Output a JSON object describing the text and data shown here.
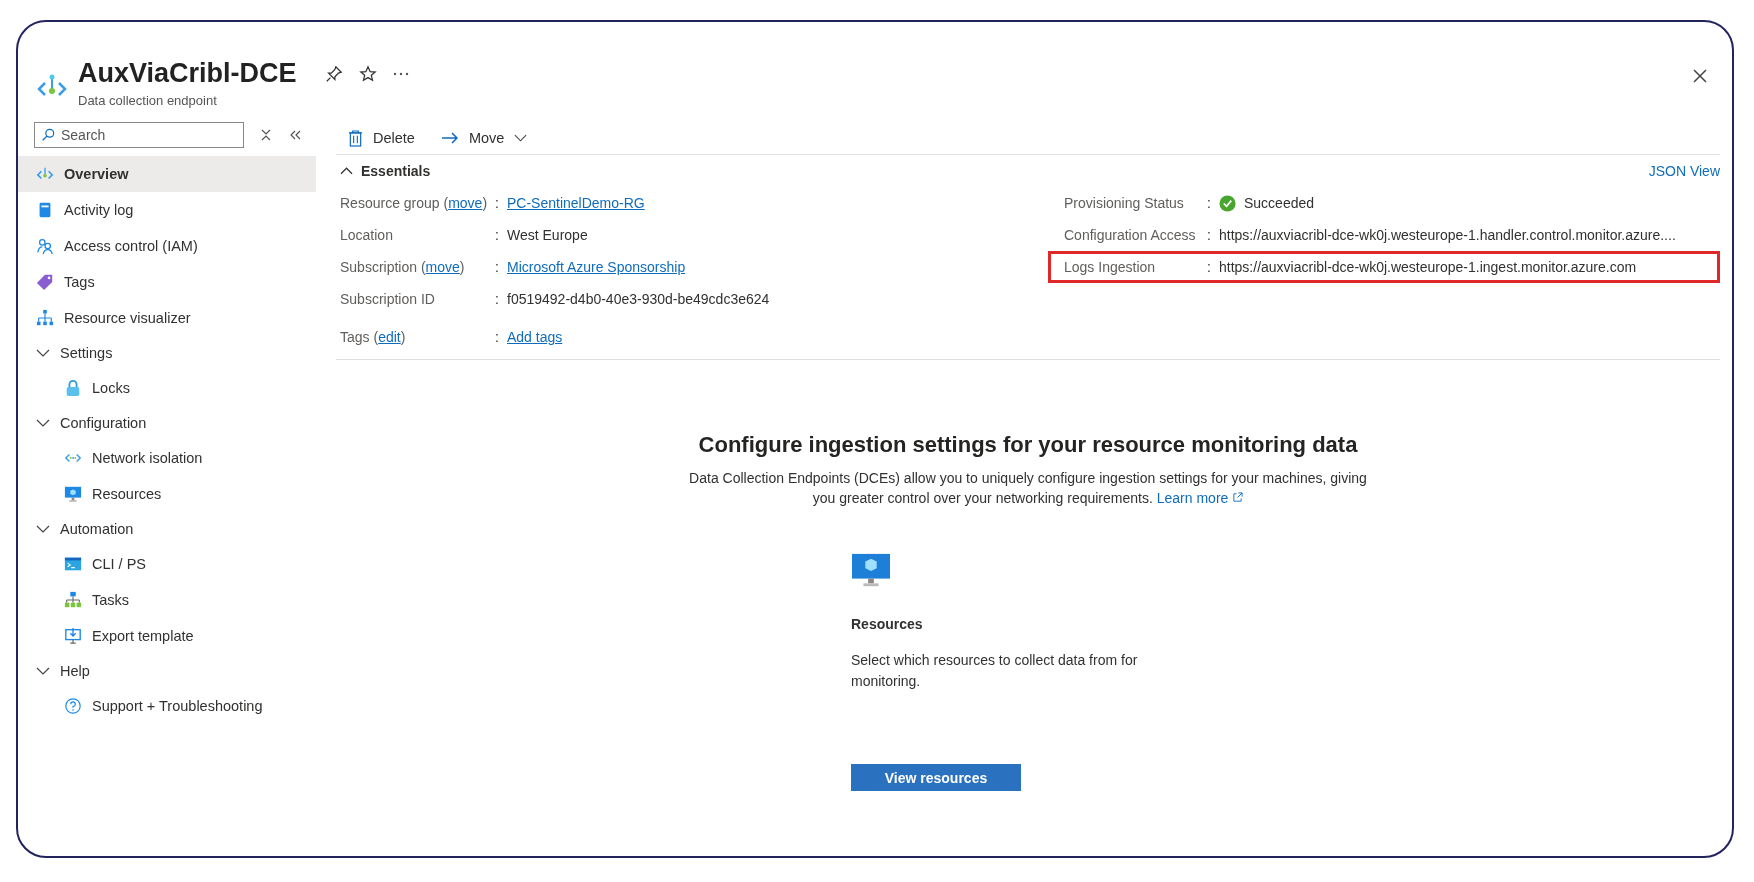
{
  "header": {
    "title": "AuxViaCribl-DCE",
    "subtitle": "Data collection endpoint"
  },
  "sidebar": {
    "search": {
      "placeholder": "Search"
    },
    "items": [
      {
        "kind": "item",
        "label": "Overview",
        "selected": true
      },
      {
        "kind": "item",
        "label": "Activity log",
        "selected": false
      },
      {
        "kind": "item",
        "label": "Access control (IAM)",
        "selected": false
      },
      {
        "kind": "item",
        "label": "Tags",
        "selected": false
      },
      {
        "kind": "item",
        "label": "Resource visualizer",
        "selected": false
      },
      {
        "kind": "group",
        "label": "Settings",
        "expanded": true,
        "children": [
          {
            "label": "Locks",
            "selected": false
          }
        ]
      },
      {
        "kind": "group",
        "label": "Configuration",
        "expanded": true,
        "children": [
          {
            "label": "Network isolation",
            "selected": false
          },
          {
            "label": "Resources",
            "selected": false
          }
        ]
      },
      {
        "kind": "group",
        "label": "Automation",
        "expanded": true,
        "children": [
          {
            "label": "CLI / PS",
            "selected": false
          },
          {
            "label": "Tasks",
            "selected": false
          },
          {
            "label": "Export template",
            "selected": false
          }
        ]
      },
      {
        "kind": "group",
        "label": "Help",
        "expanded": true,
        "children": [
          {
            "label": "Support + Troubleshooting",
            "selected": false
          }
        ]
      }
    ]
  },
  "toolbar": [
    {
      "kind": "delete",
      "label": "Delete"
    },
    {
      "kind": "move",
      "label": "Move"
    }
  ],
  "essentials": {
    "title": "Essentials",
    "expanded": true,
    "json_view": "JSON View",
    "left": [
      {
        "label": "Resource group (",
        "label_link": "move",
        "label_end": ")",
        "sep": ":",
        "value": "PC-SentinelDemo-RG",
        "value_link": true
      },
      {
        "label": "Location",
        "sep": ":",
        "value": "West Europe",
        "value_link": false
      },
      {
        "label": "Subscription (",
        "label_link": "move",
        "label_end": ")",
        "sep": ":",
        "value": "Microsoft Azure Sponsorship",
        "value_link": true
      },
      {
        "label": "Subscription ID",
        "sep": ":",
        "value": "f0519492-d4b0-40e3-930d-be49cdc3e624",
        "value_link": false
      }
    ],
    "right": [
      {
        "label": "Provisioning Status",
        "sep": ":",
        "value": "Succeeded",
        "kind": "status",
        "highlighted": false
      },
      {
        "label": "Configuration Access",
        "sep": ":",
        "value": "https://auxviacribl-dce-wk0j.westeurope-1.handler.control.monitor.azure....",
        "kind": "text",
        "highlighted": false
      },
      {
        "label": "Logs Ingestion",
        "sep": ":",
        "value": "https://auxviacribl-dce-wk0j.westeurope-1.ingest.monitor.azure.com",
        "kind": "text",
        "highlighted": true
      }
    ],
    "tags": {
      "label": "Tags (",
      "label_link": "edit",
      "label_end": ")",
      "sep": ":",
      "value": "Add tags"
    }
  },
  "promo": {
    "title": "Configure ingestion settings for your resource monitoring data",
    "text": "Data Collection Endpoints (DCEs) allow you to uniquely configure ingestion settings for your machines, giving you greater control over your networking requirements.",
    "link": "Learn more",
    "card": {
      "title": "Resources",
      "text": "Select which resources to collect data from for monitoring.",
      "button": "View resources"
    }
  }
}
